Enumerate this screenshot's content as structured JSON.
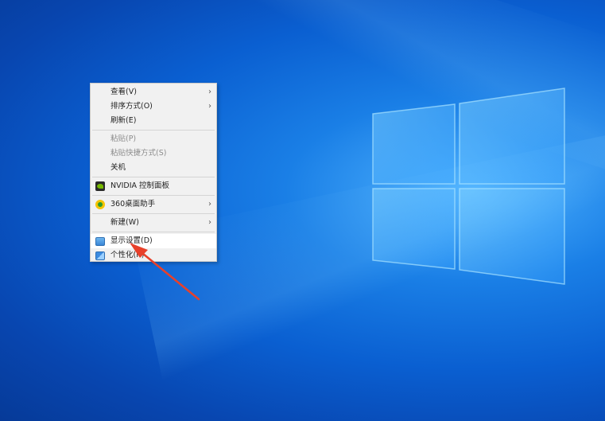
{
  "context_menu": {
    "items": [
      {
        "label": "查看(V)",
        "has_submenu": true,
        "enabled": true
      },
      {
        "label": "排序方式(O)",
        "has_submenu": true,
        "enabled": true
      },
      {
        "label": "刷新(E)",
        "has_submenu": false,
        "enabled": true
      },
      {
        "label": "粘贴(P)",
        "has_submenu": false,
        "enabled": false
      },
      {
        "label": "粘贴快捷方式(S)",
        "has_submenu": false,
        "enabled": false
      },
      {
        "label": "关机",
        "has_submenu": false,
        "enabled": true
      },
      {
        "label": "NVIDIA 控制面板",
        "has_submenu": false,
        "enabled": true,
        "icon": "nvidia-icon"
      },
      {
        "label": "360桌面助手",
        "has_submenu": true,
        "enabled": true,
        "icon": "360-icon"
      },
      {
        "label": "新建(W)",
        "has_submenu": true,
        "enabled": true
      },
      {
        "label": "显示设置(D)",
        "has_submenu": false,
        "enabled": true,
        "icon": "display-settings-icon",
        "highlighted": true
      },
      {
        "label": "个性化(R)",
        "has_submenu": false,
        "enabled": true,
        "icon": "personalize-icon"
      }
    ]
  },
  "colors": {
    "desktop_blue": "#0a5fd1",
    "menu_background": "#f1f1f1",
    "annotation_arrow": "#e8402a"
  }
}
